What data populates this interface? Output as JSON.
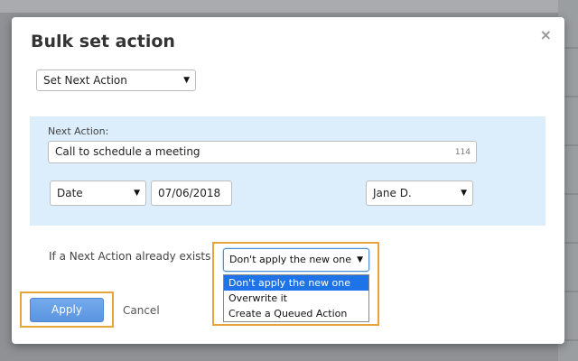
{
  "modal": {
    "title": "Bulk set action",
    "close_glyph": "×"
  },
  "action_type": {
    "selected": "Set Next Action"
  },
  "next_action": {
    "label": "Next Action:",
    "value": "Call to schedule a meeting",
    "char_counter": "114",
    "date_type": "Date",
    "date_value": "07/06/2018",
    "assignee": "Jane D."
  },
  "existing": {
    "label": "If a Next Action already exists",
    "selected": "Don't apply the new one",
    "options": [
      "Don't apply the new one",
      "Overwrite it",
      "Create a Queued Action"
    ]
  },
  "footer": {
    "apply_label": "Apply",
    "cancel_label": "Cancel"
  },
  "icons": {
    "caret": "caret-down-icon",
    "close": "close-icon"
  },
  "colors": {
    "panel": "#dcedfb",
    "highlight": "#e8a33c",
    "primary": "#5b94e0",
    "option_selected": "#1e73e8"
  }
}
